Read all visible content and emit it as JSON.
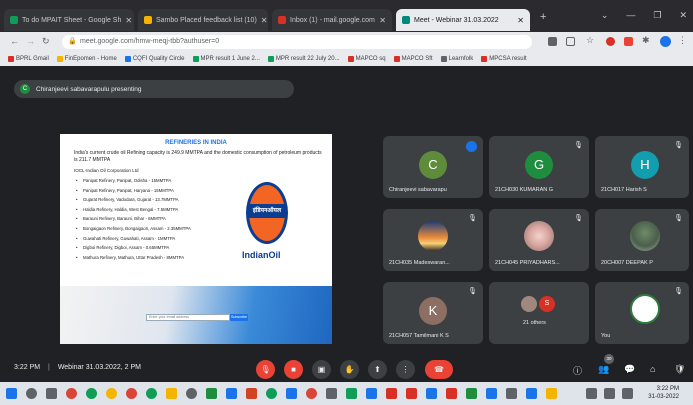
{
  "browser": {
    "tabs": [
      {
        "label": "To do MPAIT Sheet - Google Sh",
        "color": "#0f9d58"
      },
      {
        "label": "Sambo Placed feedback list (10)",
        "color": "#f4b400"
      },
      {
        "label": "Inbox (1) - mail.google.com",
        "color": "#d93025"
      },
      {
        "label": "Meet - Webinar 31.03.2022",
        "color": "#00897b",
        "active": true
      }
    ],
    "new_tab": "+",
    "url": "meet.google.com/hmw-meqj-tbb?authuser=0",
    "bookmarks": [
      "BPRL Gmail",
      "FinEpomen - Home",
      "CQFI Quality Circle",
      "MPR result 1 June 2...",
      "MPR result 22 July 20...",
      "MAPCO sq",
      "MAPCO Sft",
      "Learnfolk",
      "MPCSA result"
    ]
  },
  "meet": {
    "presenting_initial": "C",
    "presenting_text": "Chiranjeevi sabavarapulu presenting",
    "slide": {
      "title": "REFINERIES IN INDIA",
      "intro": "India's current crude oil Refining capacity is 249.9 MMTPA and the domestic consumption of petroleum products is 211.7 MMTPA",
      "owner": "IOCL-Indian Oil Corporation Ltd",
      "refineries": [
        "Panipat Refinery, Panipat, Odisha - 15MMTPA",
        "Panipat Refinery, Panipat, Haryana - 15MMTPA",
        "Gujarat Refinery, Vadodara, Gujarat - 13.7MMTPA",
        "Haldia Refinery, Haldia, West Bengal - 7.5MMTPA",
        "Barauni Refinery, Barauni, Bihar - 6MMTPA",
        "Bongaigaon Refinery, Bongaigaon, Assam - 2.35MMTPA",
        "Guwahati Refinery, Guwahati, Assam - 1MMTPA",
        "Digboi Refinery, Digboi, Assam - 0.65MMTPA",
        "Mathura Refinery, Mathura, Uttar Pradesh - 8MMTPA"
      ],
      "logo_band_text": "इंडियनऑयल",
      "logo_text": "IndianOil",
      "footer_input": "Enter your email address",
      "footer_button": "Subscribe"
    },
    "participants": [
      {
        "initial": "C",
        "name": "Chiranjeevi sabavarapu",
        "color": "#5f8c3a",
        "speaking": true
      },
      {
        "initial": "G",
        "name": "21CH030 KUMARAN G",
        "color": "#1e8e3e"
      },
      {
        "initial": "H",
        "name": "21CH017 Harish S",
        "color": "#129eaf"
      },
      {
        "initial": "",
        "name": "21CH035 Madeswaran...",
        "photo": "sunset"
      },
      {
        "initial": "",
        "name": "21CH045 PRIYADHARS...",
        "photo": "flower"
      },
      {
        "initial": "",
        "name": "20CH007 DEEPAK P",
        "photo": "tree"
      },
      {
        "initial": "K",
        "name": "21CH057 Tamilmani K S",
        "color": "#8d6e63"
      },
      {
        "initial": "S",
        "name": "21 others",
        "color": "#d93025",
        "others": true
      },
      {
        "initial": "",
        "name": "You",
        "photo": "logo"
      }
    ],
    "bottom": {
      "time": "3:22 PM",
      "meeting": "Webinar 31.03.2022, 2 PM",
      "participant_count": "30"
    }
  },
  "taskbar": {
    "clock_time": "3:22 PM",
    "clock_date": "31-03-2022"
  }
}
